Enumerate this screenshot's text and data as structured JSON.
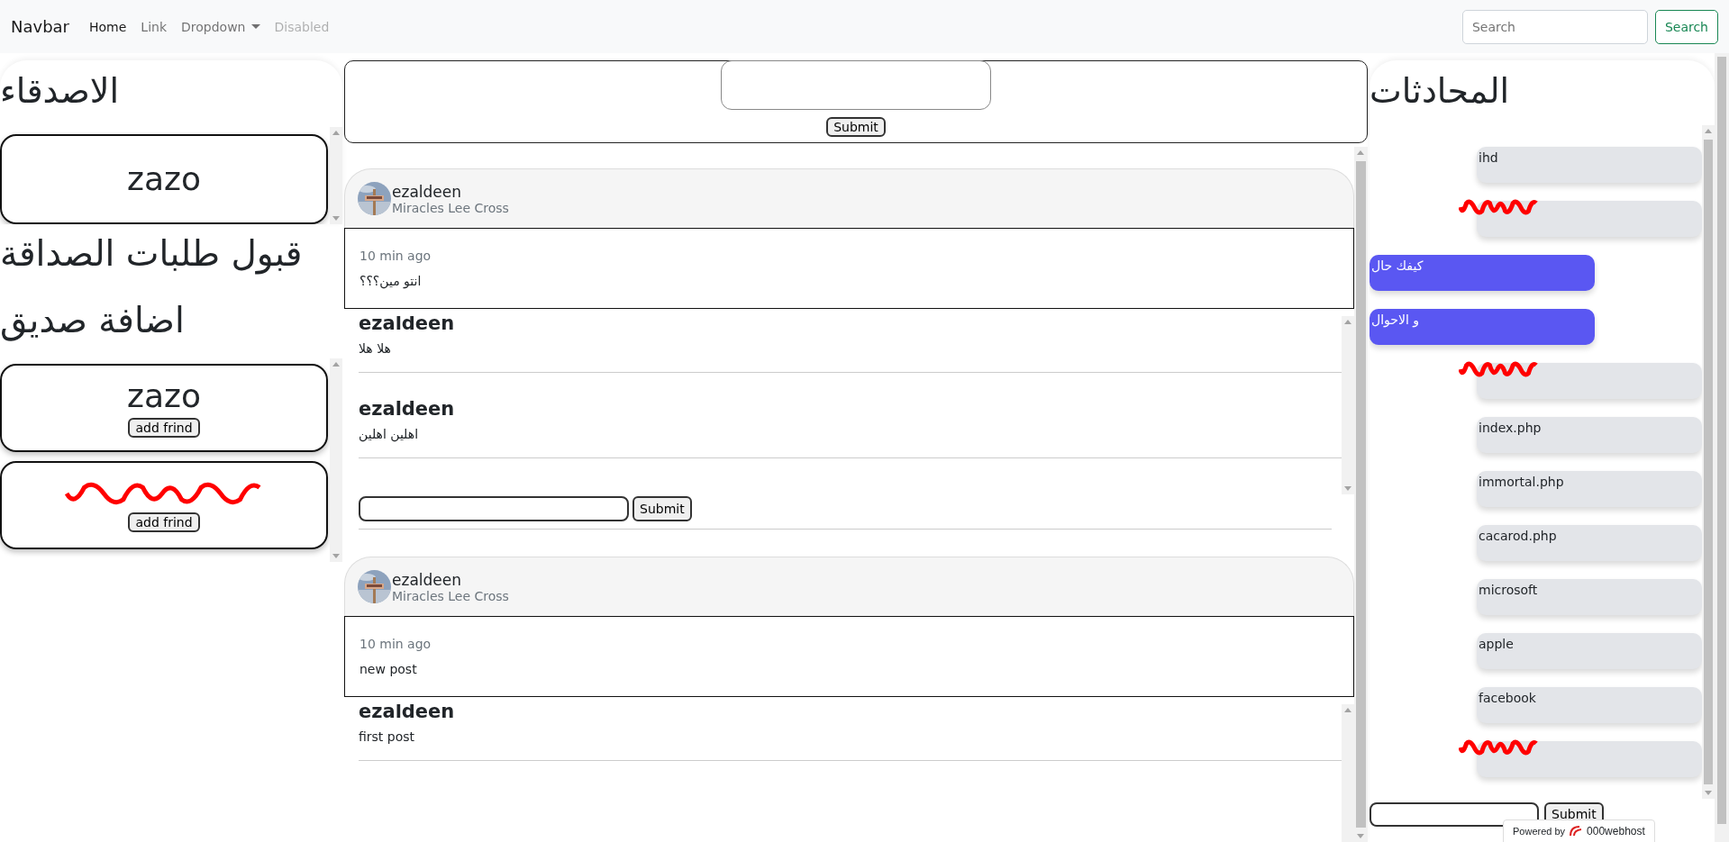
{
  "navbar": {
    "brand": "Navbar",
    "links": [
      {
        "label": "Home",
        "kind": "link",
        "selected": true,
        "disabled": false
      },
      {
        "label": "Link",
        "kind": "link",
        "selected": false,
        "disabled": false
      },
      {
        "label": "Dropdown",
        "kind": "dropdown",
        "selected": false,
        "disabled": false
      },
      {
        "label": "Disabled",
        "kind": "link",
        "selected": false,
        "disabled": true
      }
    ],
    "search": {
      "placeholder": "Search",
      "button": "Search"
    }
  },
  "friends": {
    "title": "الاصدقاء",
    "items": [
      {
        "name": "zazo"
      }
    ]
  },
  "requests": {
    "title": "قبول طلبات الصداقة"
  },
  "add_friend": {
    "title": "اضافة صديق",
    "items": [
      {
        "name": "zazo",
        "redacted": false,
        "button": "add frind"
      },
      {
        "redacted": true,
        "button": "add frind"
      }
    ]
  },
  "post_form": {
    "button": "Submit"
  },
  "posts": [
    {
      "author": "ezaldeen",
      "subtitle": "Miracles Lee Cross",
      "time": "10 min ago",
      "text": "انتو مين؟؟؟",
      "comments": [
        {
          "author": "ezaldeen",
          "text": "هلا هلا"
        },
        {
          "author": "ezaldeen",
          "text": "اهلين اهلين"
        }
      ],
      "comment_form": {
        "button": "Submit"
      }
    },
    {
      "author": "ezaldeen",
      "subtitle": "Miracles Lee Cross",
      "time": "10 min ago",
      "text": "new post",
      "comments": [
        {
          "author": "ezaldeen",
          "text": "first post"
        }
      ]
    }
  ],
  "chats": {
    "title": "المحادثات",
    "messages": [
      {
        "kind": "received",
        "text": "ihd",
        "redacted": false
      },
      {
        "kind": "received",
        "redacted": true
      },
      {
        "kind": "sent",
        "text": "كيفك حال",
        "redacted": false
      },
      {
        "kind": "sent",
        "text": "و الاحوال",
        "redacted": false
      },
      {
        "kind": "received",
        "redacted": true
      },
      {
        "kind": "received",
        "text": "index.php",
        "redacted": false
      },
      {
        "kind": "received",
        "text": "immortal.php",
        "redacted": false
      },
      {
        "kind": "received",
        "text": "cacarod.php",
        "redacted": false
      },
      {
        "kind": "received",
        "text": "microsoft",
        "redacted": false
      },
      {
        "kind": "received",
        "text": "apple",
        "redacted": false
      },
      {
        "kind": "received",
        "text": "facebook",
        "redacted": false
      },
      {
        "kind": "received",
        "redacted": true
      }
    ],
    "form": {
      "button": "Submit"
    }
  },
  "badge": {
    "prefix": "Powered by",
    "name": "000webhost"
  }
}
